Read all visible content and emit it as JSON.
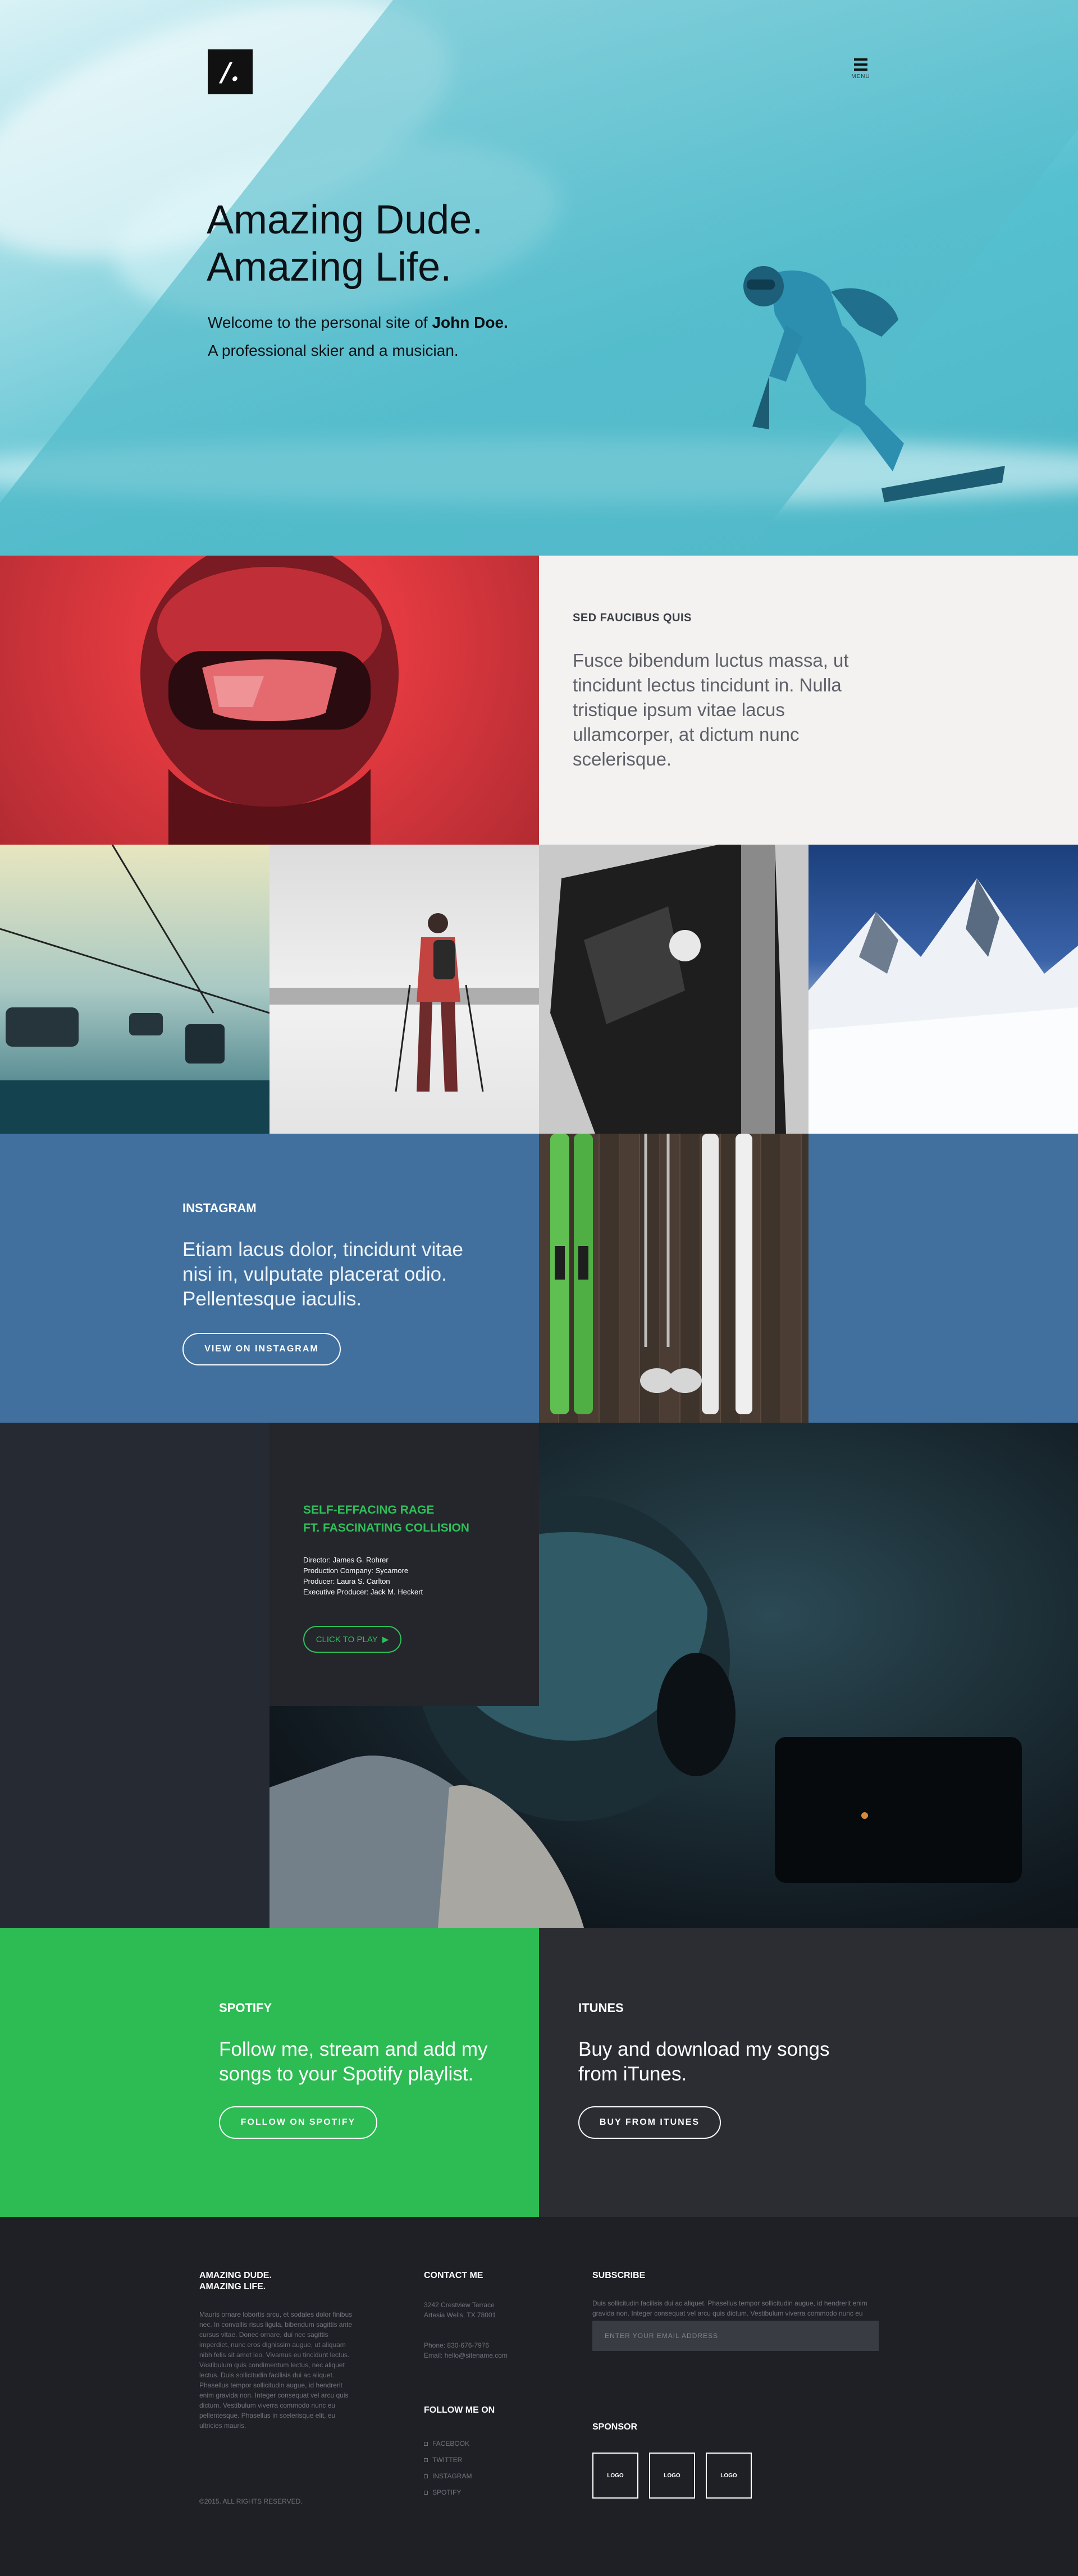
{
  "hero": {
    "logo_text": "/.",
    "menu_label": "MENU",
    "title_line1": "Amazing Dude.",
    "title_line2": "Amazing Life.",
    "subtitle_prefix": "Welcome to the personal site of ",
    "subtitle_name": "John Doe.",
    "subtitle_line2": "A professional skier and a musician."
  },
  "feature": {
    "kicker": "SED FAUCIBUS QUIS",
    "text": "Fusce bibendum luctus massa, ut tincidunt lectus tincidunt in. Nulla tristique ipsum vitae lacus ullamcorper, at dictum nunc scelerisque."
  },
  "instagram": {
    "kicker": "INSTAGRAM",
    "text": "Etiam lacus dolor, tincidunt vitae nisi in, vulputate placerat odio. Pellentesque iaculis.",
    "button": "VIEW ON INSTAGRAM"
  },
  "video": {
    "title_line1": "SELF-EFFACING RAGE",
    "title_line2": "FT. FASCINATING COLLISION",
    "credits": [
      "Director: James G. Rohrer",
      "Production Company: Sycamore",
      "Producer: Laura S. Carlton",
      "Executive Producer: Jack M. Heckert"
    ],
    "play_label": "CLICK TO PLAY"
  },
  "spotify": {
    "kicker": "SPOTIFY",
    "text": "Follow me, stream and add my songs to your Spotify playlist.",
    "button": "FOLLOW ON SPOTIFY"
  },
  "itunes": {
    "kicker": "ITUNES",
    "text": "Buy and download my songs from iTunes.",
    "button": "BUY FROM ITUNES"
  },
  "footer": {
    "brand_line1": "AMAZING DUDE.",
    "brand_line2": "AMAZING LIFE.",
    "about": "Mauris ornare lobortis arcu, et sodales dolor finibus nec. In convallis risus ligula, bibendum sagittis ante cursus vitae. Donec ornare, dui nec sagittis imperdiet, nunc eros dignissim augue, ut aliquam nibh felis sit amet leo. Vivamus eu tincidunt lectus. Vestibulum quis condimentum lectus, nec aliquet lectus. Duis sollicitudin facilisis dui ac aliquet. Phasellus tempor sollicitudin augue, id hendrerit enim gravida non. Integer consequat vel arcu quis dictum. Vestibulum viverra commodo nunc eu pellentesque. Phasellus in scelerisque elit, eu ultricies mauris.",
    "copyright": "©2015. ALL RIGHTS RESERVED.",
    "contact_title": "CONTACT ME",
    "address_line1": "3242 Crestview Terrace",
    "address_line2": "Artesia Wells, TX 78001",
    "phone": "Phone: 830-676-7976",
    "email_text": "Email: hello@sitename.com",
    "follow_title": "FOLLOW ME ON",
    "social": [
      "FACEBOOK",
      "TWITTER",
      "INSTAGRAM",
      "SPOTIFY"
    ],
    "subscribe_title": "SUBSCRIBE",
    "subscribe_text": "Duis sollicitudin facilisis dui ac aliquet. Phasellus tempor sollicitudin augue, id hendrerit enim gravida non. Integer consequat vel arcu quis dictum. Vestibulum viverra commodo nunc eu pellentesque.",
    "email_placeholder": "ENTER YOUR EMAIL ADDRESS",
    "sponsor_title": "SPONSOR",
    "sponsors": [
      "LOGO",
      "LOGO",
      "LOGO"
    ]
  }
}
